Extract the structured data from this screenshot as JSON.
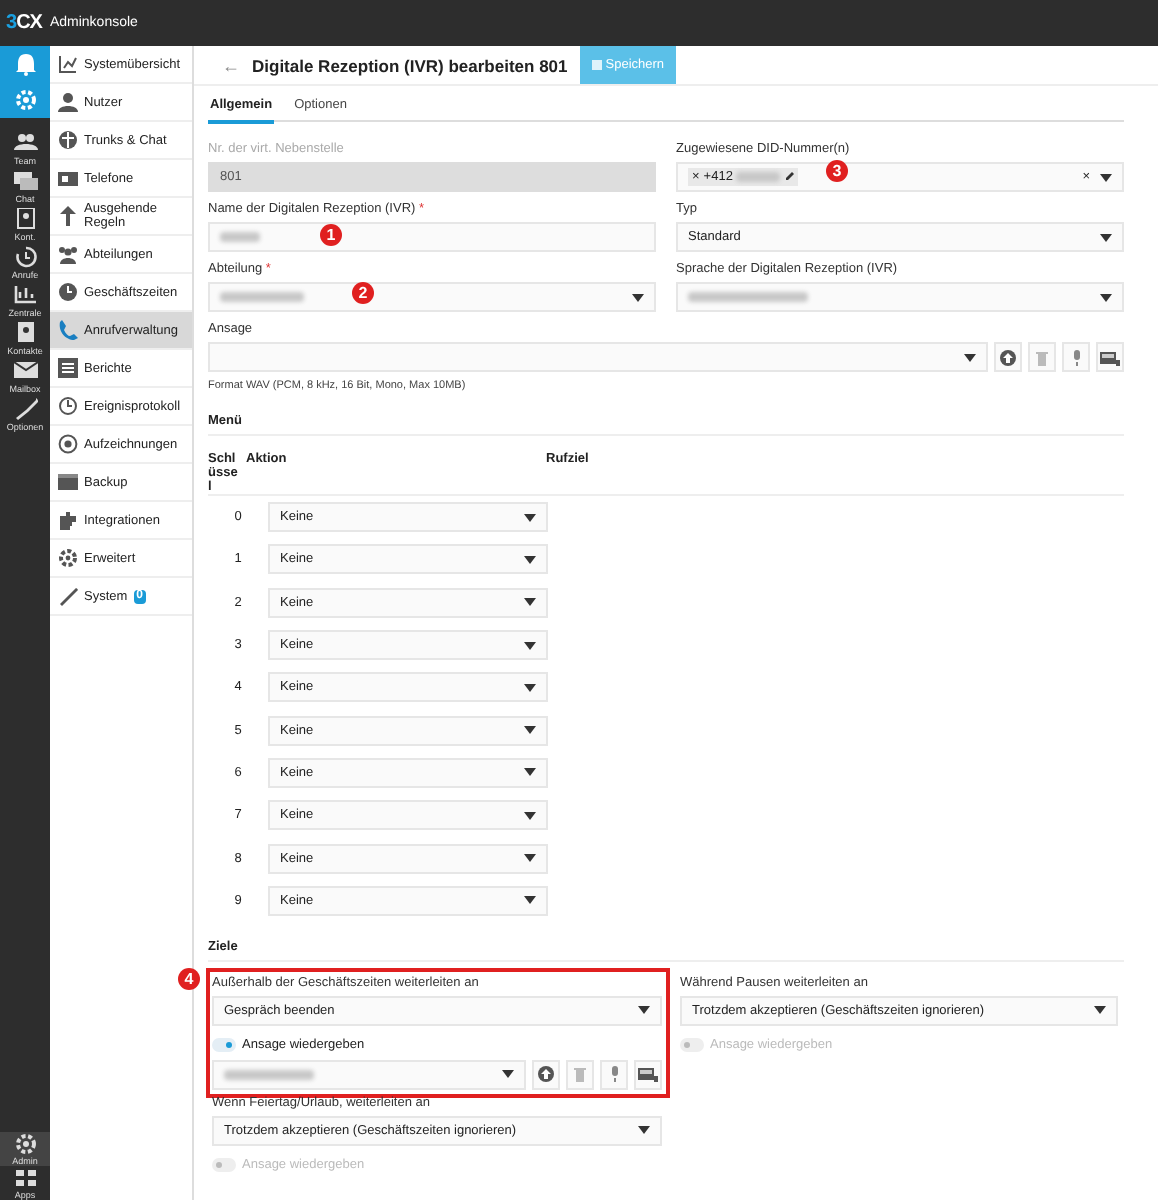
{
  "topbar": {
    "logo_mark": "3",
    "logo_rest": "CX",
    "title": "Adminkonsole"
  },
  "rail": {
    "top": [
      {
        "selected": true
      },
      {
        "selected": true
      }
    ],
    "items": [
      {
        "label": "Team"
      },
      {
        "label": "Chat"
      },
      {
        "label": "Kont."
      },
      {
        "label": "Anrufe"
      },
      {
        "label": "Zentrale"
      },
      {
        "label": "Kontakte"
      },
      {
        "label": "Mailbox"
      },
      {
        "label": "Optionen"
      }
    ],
    "bottom": [
      {
        "label": "Admin",
        "selected": true
      },
      {
        "label": "Apps",
        "selected": false
      }
    ]
  },
  "sidebar": {
    "items": [
      {
        "label": "Systemübersicht",
        "selected": false
      },
      {
        "label": "Nutzer",
        "selected": false
      },
      {
        "label": "Trunks & Chat",
        "selected": false
      },
      {
        "label": "Telefone",
        "selected": false
      },
      {
        "label": "Ausgehende Regeln",
        "selected": false
      },
      {
        "label": "Abteilungen",
        "selected": false
      },
      {
        "label": "Geschäftszeiten",
        "selected": false
      },
      {
        "label": "Anrufverwaltung",
        "selected": true
      },
      {
        "label": "Berichte",
        "selected": false
      },
      {
        "label": "Ereignisprotokoll",
        "selected": false
      },
      {
        "label": "Aufzeichnungen",
        "selected": false
      },
      {
        "label": "Backup",
        "selected": false
      },
      {
        "label": "Integrationen",
        "selected": false
      },
      {
        "label": "Erweitert",
        "selected": false
      },
      {
        "label": "System",
        "selected": false,
        "badge": "0"
      }
    ]
  },
  "header": {
    "back": "←",
    "title": "Digitale Rezeption (IVR) bearbeiten 801",
    "save": "Speichern"
  },
  "tabs": [
    {
      "label": "Allgemein",
      "selected": true
    },
    {
      "label": "Optionen",
      "selected": false
    }
  ],
  "fields": [
    {
      "kind": "text",
      "label": "Nr. der virt. Nebenstelle",
      "disabled": true,
      "value": "801"
    },
    {
      "kind": "multi",
      "label": "Zugewiesene DID-Nummer(n)",
      "disabled": false,
      "chip_remove": "×",
      "chip": "+412",
      "redacted": true,
      "clear": "×",
      "marker": "3"
    },
    {
      "kind": "text",
      "label": "Name der Digitalen Rezeption (IVR)",
      "required_mark": "*",
      "disabled": false,
      "redacted": true,
      "marker": "1"
    },
    {
      "kind": "select",
      "label": "Typ",
      "disabled": false,
      "value": "Standard"
    },
    {
      "kind": "select",
      "label": "Abteilung",
      "required_mark": "*",
      "disabled": false,
      "redacted": true,
      "marker": "2"
    },
    {
      "kind": "select",
      "label": "Sprache der Digitalen Rezeption (IVR)",
      "disabled": false,
      "redacted": true
    }
  ],
  "prompt": {
    "label": "Ansage",
    "hint": "Format WAV (PCM, 8 kHz, 16 Bit, Mono, Max 10MB)"
  },
  "menu": {
    "title": "Menü",
    "columns": [
      "Schlüssel",
      "Aktion",
      "Rufziel"
    ],
    "rows": [
      {
        "key": "0",
        "action": "Keine"
      },
      {
        "key": "1",
        "action": "Keine"
      },
      {
        "key": "2",
        "action": "Keine"
      },
      {
        "key": "3",
        "action": "Keine"
      },
      {
        "key": "4",
        "action": "Keine"
      },
      {
        "key": "5",
        "action": "Keine"
      },
      {
        "key": "6",
        "action": "Keine"
      },
      {
        "key": "7",
        "action": "Keine"
      },
      {
        "key": "8",
        "action": "Keine"
      },
      {
        "key": "9",
        "action": "Keine"
      }
    ]
  },
  "destinations": {
    "title": "Ziele",
    "groups": [
      {
        "label": "Außerhalb der Geschäftszeiten weiterleiten an",
        "value": "Gespräch beenden",
        "toggle_label": "Ansage wiedergeben",
        "on": true,
        "highlighted": true,
        "marker": "4",
        "prompt_redacted": true
      },
      {
        "label": "Während Pausen weiterleiten an",
        "value": "Trotzdem akzeptieren (Geschäftszeiten ignorieren)",
        "toggle_label": "Ansage wiedergeben",
        "on": false
      },
      {
        "label": "Wenn Feiertag/Urlaub, weiterleiten an",
        "value": "Trotzdem akzeptieren (Geschäftszeiten ignorieren)",
        "toggle_label": "Ansage wiedergeben",
        "on": false
      }
    ]
  }
}
